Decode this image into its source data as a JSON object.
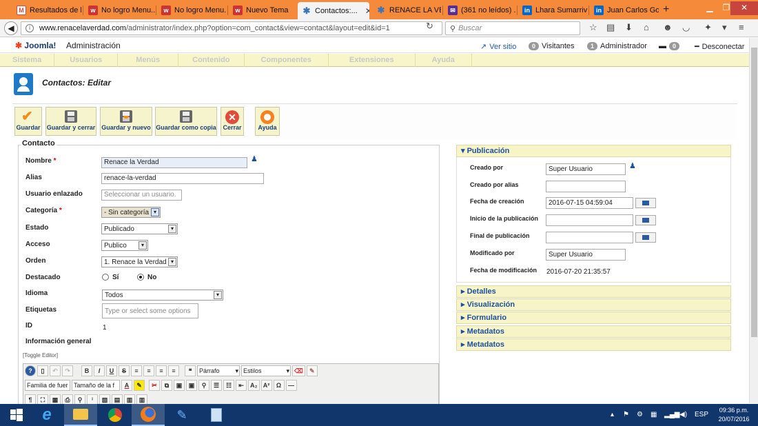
{
  "browser": {
    "tabs": [
      {
        "label": "Resultados de l...",
        "icon": "gmail-icon"
      },
      {
        "label": "No logro Menu...",
        "icon": "w-icon"
      },
      {
        "label": "No logro Menu...",
        "icon": "w-icon"
      },
      {
        "label": "Nuevo Tema",
        "icon": "w-icon"
      },
      {
        "label": "Contactos:...",
        "icon": "joomla-icon"
      },
      {
        "label": "RENACE LA VE...",
        "icon": "joomla-icon"
      },
      {
        "label": "(361 no leídos) ...",
        "icon": "yahoo-mail-icon"
      },
      {
        "label": "Lhara Sumarriv...",
        "icon": "linkedin-icon"
      },
      {
        "label": "Juan Carlos Go...",
        "icon": "linkedin-icon"
      }
    ],
    "new_tab": "+",
    "url_host": "www.renacelaverdad.com",
    "url_path": "/administrator/index.php?option=com_contact&view=contact&layout=edit&id=1",
    "search_placeholder": "Buscar",
    "accent": "#f48a3a"
  },
  "header": {
    "logo_text": "Joomla!",
    "title": "Administración",
    "view_site": "Ver sitio",
    "visitors_count": "0",
    "visitors_label": "Visitantes",
    "admins_count": "1",
    "admins_label": "Administrador",
    "messages_count": "0",
    "logout": "Desconectar"
  },
  "menu": [
    "Sistema",
    "Usuarios",
    "Menús",
    "Contenido",
    "Componentes",
    "Extensiones",
    "Ayuda"
  ],
  "page": {
    "title": "Contactos: Editar"
  },
  "toolbar": {
    "save": "Guardar",
    "save_close": "Guardar y cerrar",
    "save_new": "Guardar y nuevo",
    "save_copy": "Guardar como copia",
    "close": "Cerrar",
    "help": "Ayuda"
  },
  "form": {
    "legend": "Contacto",
    "name_label": "Nombre",
    "name_value": "Renace la Verdad",
    "alias_label": "Alias",
    "alias_value": "renace-la-verdad",
    "linked_user_label": "Usuario enlazado",
    "linked_user_placeholder": "Seleccionar un usuario.",
    "category_label": "Categoría",
    "category_value": "- Sin categoría",
    "status_label": "Estado",
    "status_value": "Publicado",
    "access_label": "Acceso",
    "access_value": "Publico",
    "order_label": "Orden",
    "order_value": "1. Renace la Verdad",
    "featured_label": "Destacado",
    "featured_yes": "Sí",
    "featured_no": "No",
    "featured_selected": "No",
    "language_label": "Idioma",
    "language_value": "Todos",
    "tags_label": "Etiquetas",
    "tags_placeholder": "Type or select some options",
    "id_label": "ID",
    "id_value": "1",
    "misc_label": "Información general",
    "toggle_editor": "[Toggle Editor]"
  },
  "editor": {
    "format_value": "Párrafo",
    "styles_value": "Estilos",
    "font_family": "Familia de fuer",
    "font_size": "Tamaño de la f"
  },
  "publishing": {
    "title": "Publicación",
    "created_by_label": "Creado por",
    "created_by_value": "Super Usuario",
    "created_alias_label": "Creado por alias",
    "created_date_label": "Fecha de creación",
    "created_date_value": "2016-07-15 04:59:04",
    "publish_up_label": "Inicio de la publicación",
    "publish_down_label": "Final de publicación",
    "modified_by_label": "Modificado por",
    "modified_by_value": "Super Usuario",
    "modified_date_label": "Fecha de modificación",
    "modified_date_value": "2016-07-20 21:35:57"
  },
  "panels": [
    "Detalles",
    "Visualización",
    "Formulario",
    "Metadatos",
    "Metadatos"
  ],
  "taskbar": {
    "apps": [
      "start-icon",
      "ie-icon",
      "explorer-icon",
      "chrome-icon",
      "firefox-icon",
      "tool-icon",
      "calculator-icon"
    ],
    "lang": "ESP",
    "time": "09:36 p.m.",
    "date": "20/07/2016"
  }
}
